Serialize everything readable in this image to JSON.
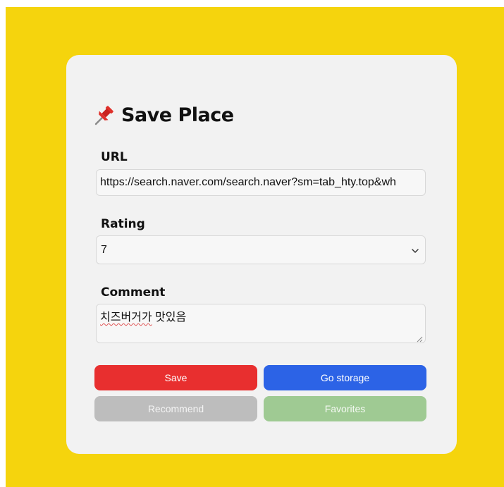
{
  "form": {
    "title": "Save Place",
    "title_icon": "pushpin-icon",
    "url": {
      "label": "URL",
      "value": "https://search.naver.com/search.naver?sm=tab_hty.top&wh"
    },
    "rating": {
      "label": "Rating",
      "selected": "7"
    },
    "comment": {
      "label": "Comment",
      "value_misspelled": "치즈버거가",
      "value_rest": " 맛있음"
    }
  },
  "buttons": {
    "save": "Save",
    "go_storage": "Go storage",
    "recommend": "Recommend",
    "favorites": "Favorites"
  },
  "colors": {
    "background": "#f5d40d",
    "card": "#f2f2f2",
    "save": "#e82f2f",
    "go_storage": "#2c63e6",
    "recommend": "#bdbdbd",
    "favorites": "#9fca93"
  }
}
